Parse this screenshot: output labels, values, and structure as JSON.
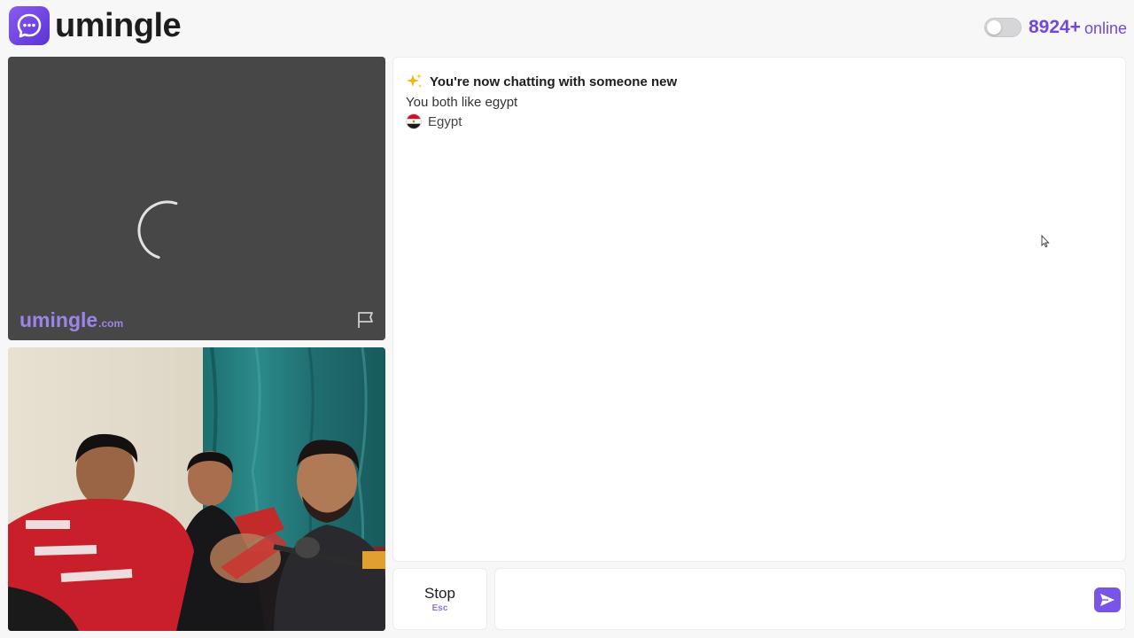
{
  "header": {
    "brand": "umingle",
    "online_count": "8924+",
    "online_label": "online",
    "toggle_state": "off"
  },
  "remote_video": {
    "status": "loading",
    "watermark_main": "umingle",
    "watermark_domain": ".com",
    "icons": [
      "spinner-icon",
      "flag-icon"
    ]
  },
  "local_video": {
    "content": "webcam"
  },
  "chat": {
    "intro_title": "You're now chatting with someone new",
    "common_interest": "You both like egypt",
    "country": "Egypt",
    "icons": [
      "sparkle-icon",
      "egypt-flag-icon"
    ]
  },
  "controls": {
    "stop_label": "Stop",
    "stop_shortcut": "Esc",
    "input_placeholder": "",
    "send_icon": "send-icon"
  },
  "colors": {
    "accent": "#7048e0",
    "brand_gradient_start": "#8a5cf0",
    "brand_gradient_end": "#5b34d6",
    "remote_bg": "#474747",
    "page_bg": "#f7f7f8"
  }
}
